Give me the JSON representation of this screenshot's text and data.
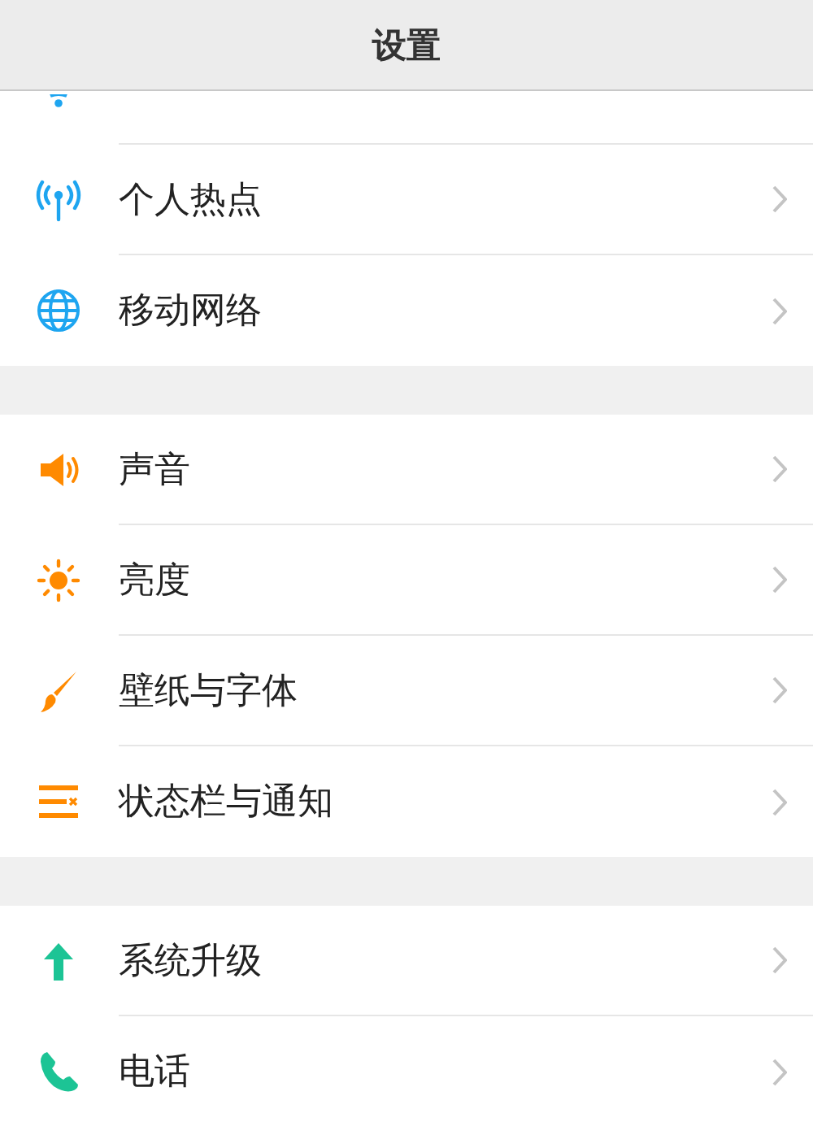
{
  "header": {
    "title": "设置"
  },
  "groups": [
    {
      "items": [
        {
          "kind": "wifi"
        },
        {
          "kind": "hotspot",
          "label": "个人热点"
        },
        {
          "kind": "globe",
          "label": "移动网络"
        }
      ]
    },
    {
      "items": [
        {
          "kind": "speaker",
          "label": "声音"
        },
        {
          "kind": "sun",
          "label": "亮度"
        },
        {
          "kind": "brush",
          "label": "壁纸与字体"
        },
        {
          "kind": "lines",
          "label": "状态栏与通知"
        }
      ]
    },
    {
      "items": [
        {
          "kind": "arrow",
          "label": "系统升级"
        },
        {
          "kind": "phone",
          "label": "电话"
        }
      ]
    }
  ]
}
